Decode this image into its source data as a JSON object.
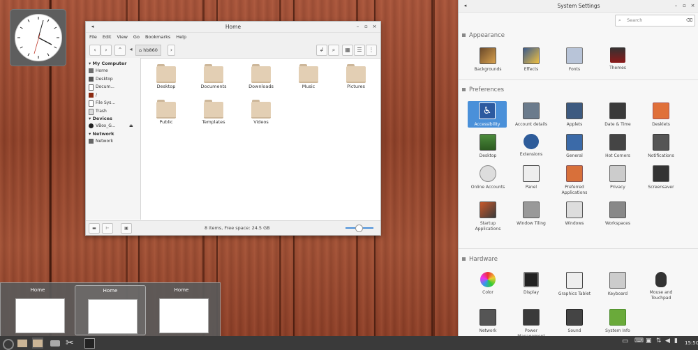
{
  "file_manager": {
    "title": "Home",
    "menu": [
      "File",
      "Edit",
      "View",
      "Go",
      "Bookmarks",
      "Help"
    ],
    "path": "hb860",
    "sidebar": {
      "sections": [
        {
          "title": "My Computer",
          "items": [
            "Home",
            "Desktop",
            "Docum...",
            "/",
            "File Sys...",
            "Trash"
          ]
        },
        {
          "title": "Devices",
          "items": [
            "VBox_G..."
          ]
        },
        {
          "title": "Network",
          "items": [
            "Network"
          ]
        }
      ]
    },
    "folders": [
      "Desktop",
      "Documents",
      "Downloads",
      "Music",
      "Pictures",
      "Public",
      "Templates",
      "Videos"
    ],
    "status": "8 items, Free space: 24.5 GB",
    "zoom_level": 0.5
  },
  "system_settings": {
    "title": "System Settings",
    "search_placeholder": "Search",
    "sections": [
      {
        "title": "Appearance",
        "items": [
          "Backgrounds",
          "Effects",
          "Fonts",
          "Themes"
        ]
      },
      {
        "title": "Preferences",
        "items": [
          "Accessibility",
          "Account details",
          "Applets",
          "Date & Time",
          "Desklets",
          "Desktop",
          "Extensions",
          "General",
          "Hot Corners",
          "Notifications",
          "Online Accounts",
          "Panel",
          "Preferred Applications",
          "Privacy",
          "Screensaver",
          "Startup Applications",
          "Window Tiling",
          "Windows",
          "Workspaces"
        ]
      },
      {
        "title": "Hardware",
        "items": [
          "Color",
          "Display",
          "Graphics Tablet",
          "Keyboard",
          "Mouse and Touchpad",
          "Network",
          "Power Management",
          "Sound",
          "System Info"
        ]
      }
    ],
    "selected": "Accessibility"
  },
  "switcher": {
    "windows": [
      "Home",
      "Home",
      "Home"
    ]
  },
  "taskbar": {
    "time": "15:50"
  },
  "colors": {
    "accent": "#4a90d9",
    "taskbar": "#3a3a3a",
    "folder": "#e3cfb4"
  }
}
